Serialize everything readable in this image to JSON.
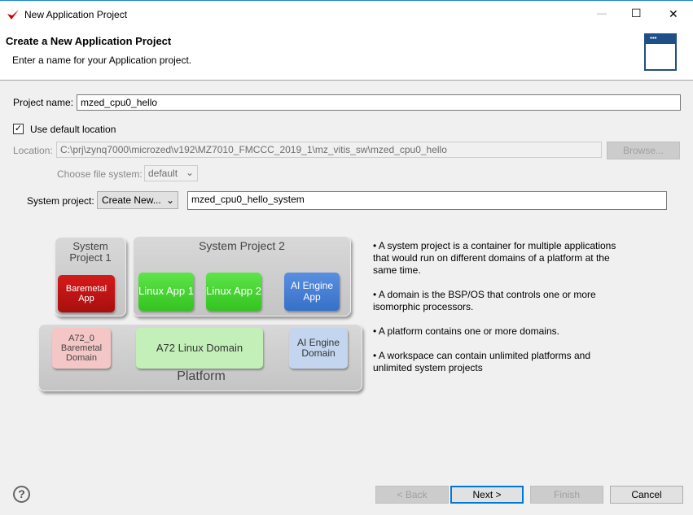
{
  "window": {
    "title": "New Application Project",
    "minimize": "—",
    "maximize": "☐",
    "close": "✕"
  },
  "header": {
    "title": "Create a New Application Project",
    "subtitle": "Enter a name for your Application project."
  },
  "form": {
    "project_name_label": "Project name:",
    "project_name_value": "mzed_cpu0_hello",
    "use_default_location_label": "Use default location",
    "use_default_location_checked": true,
    "location_label": "Location:",
    "location_value": "C:\\prj\\zynq7000\\microzed\\v192\\MZ7010_FMCCC_2019_1\\mz_vitis_sw\\mzed_cpu0_hello",
    "browse_label": "Browse...",
    "file_system_label": "Choose file system:",
    "file_system_value": "default",
    "system_project_label": "System project:",
    "system_project_select": "Create New...",
    "system_project_value": "mzed_cpu0_hello_system"
  },
  "diagram": {
    "system_project_1": "System Project 1",
    "system_project_2": "System Project 2",
    "baremetal_app": "Baremetal App",
    "linux_app_1": "Linux App 1",
    "linux_app_2": "Linux App 2",
    "ai_engine_app": "AI Engine App",
    "a72_baremetal_domain": "A72_0 Baremetal Domain",
    "a72_linux_domain": "A72 Linux Domain",
    "ai_engine_domain": "AI Engine Domain",
    "platform": "Platform"
  },
  "notes": [
    "• A system project is a container for multiple applications that would run on different domains of a platform at the same time.",
    "• A domain is the BSP/OS that controls one or more isomorphic processors.",
    "• A platform contains one or more domains.",
    "• A workspace can contain unlimited platforms and unlimited system projects"
  ],
  "buttons": {
    "help": "?",
    "back": "< Back",
    "next": "Next >",
    "finish": "Finish",
    "cancel": "Cancel"
  }
}
